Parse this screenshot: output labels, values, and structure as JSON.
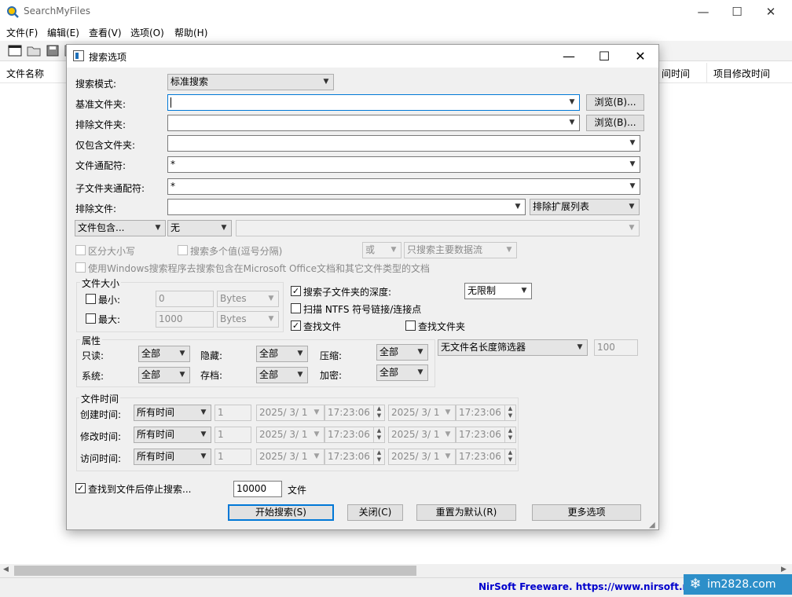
{
  "app": {
    "title": "SearchMyFiles",
    "window_controls": {
      "minimize": "—",
      "maximize": "☐",
      "close": "✕"
    },
    "menu": [
      "文件(F)",
      "编辑(E)",
      "查看(V)",
      "选项(O)",
      "帮助(H)"
    ],
    "columns": {
      "filename": "文件名称",
      "col2": "间时间",
      "col3": "项目修改时间"
    },
    "status": {
      "nirsoft": "NirSoft Freeware. https://www.nirsoft.net",
      "watermark": "im2828.com"
    }
  },
  "dialog": {
    "title": "搜索选项",
    "controls": {
      "minimize": "—",
      "maximize": "☐",
      "close": "✕"
    },
    "search_mode": {
      "label": "搜索模式:",
      "value": "标准搜索"
    },
    "base_folder": {
      "label": "基准文件夹:",
      "value": "",
      "browse": "浏览(B)..."
    },
    "exclude_folder": {
      "label": "排除文件夹:",
      "value": "",
      "browse": "浏览(B)..."
    },
    "include_only": {
      "label": "仅包含文件夹:",
      "value": ""
    },
    "file_wildcard": {
      "label": "文件通配符:",
      "value": "*"
    },
    "subfolder_wildcard": {
      "label": "子文件夹通配符:",
      "value": "*"
    },
    "exclude_files": {
      "label": "排除文件:",
      "value": "",
      "ext_list": "排除扩展列表"
    },
    "contains": {
      "type": "文件包含...",
      "mode": "无",
      "value": ""
    },
    "case_sensitive": {
      "label": "区分大小写",
      "checked": false
    },
    "multi_values": {
      "label": "搜索多个值(逗号分隔)",
      "checked": false
    },
    "or_select": "或",
    "stream_select": "只搜索主要数据流",
    "use_windows_search": {
      "label": "使用Windows搜索程序去搜索包含在Microsoft Office文档和其它文件类型的文档",
      "checked": false
    },
    "filesize": {
      "title": "文件大小",
      "min": {
        "label": "最小:",
        "value": "0",
        "unit": "Bytes",
        "checked": false
      },
      "max": {
        "label": "最大:",
        "value": "1000",
        "unit": "Bytes",
        "checked": false
      }
    },
    "subfolder_depth": {
      "label": "搜索子文件夹的深度:",
      "checked": true,
      "value": "无限制"
    },
    "scan_ntfs": {
      "label": "扫描 NTFS 符号链接/连接点",
      "checked": false
    },
    "find_files": {
      "label": "查找文件",
      "checked": true
    },
    "find_folders": {
      "label": "查找文件夹",
      "checked": false
    },
    "attributes": {
      "title": "属性",
      "readonly": {
        "label": "只读:",
        "value": "全部"
      },
      "hidden": {
        "label": "隐藏:",
        "value": "全部"
      },
      "compressed": {
        "label": "压缩:",
        "value": "全部"
      },
      "system": {
        "label": "系统:",
        "value": "全部"
      },
      "archive": {
        "label": "存档:",
        "value": "全部"
      },
      "encrypted": {
        "label": "加密:",
        "value": "全部"
      }
    },
    "name_length_filter": {
      "value": "无文件名长度筛选器",
      "number": "100"
    },
    "filetime": {
      "title": "文件时间",
      "rows": [
        {
          "label": "创建时间:",
          "mode": "所有时间",
          "num": "1",
          "date1": "2025/ 3/ 1",
          "time1": "17:23:06",
          "date2": "2025/ 3/ 1",
          "time2": "17:23:06"
        },
        {
          "label": "修改时间:",
          "mode": "所有时间",
          "num": "1",
          "date1": "2025/ 3/ 1",
          "time1": "17:23:06",
          "date2": "2025/ 3/ 1",
          "time2": "17:23:06"
        },
        {
          "label": "访问时间:",
          "mode": "所有时间",
          "num": "1",
          "date1": "2025/ 3/ 1",
          "time1": "17:23:06",
          "date2": "2025/ 3/ 1",
          "time2": "17:23:06"
        }
      ]
    },
    "stop_after": {
      "label": "查找到文件后停止搜索...",
      "checked": true,
      "value": "10000",
      "unit": "文件"
    },
    "buttons": {
      "start": "开始搜索(S)",
      "close": "关闭(C)",
      "reset": "重置为默认(R)",
      "more": "更多选项"
    }
  }
}
